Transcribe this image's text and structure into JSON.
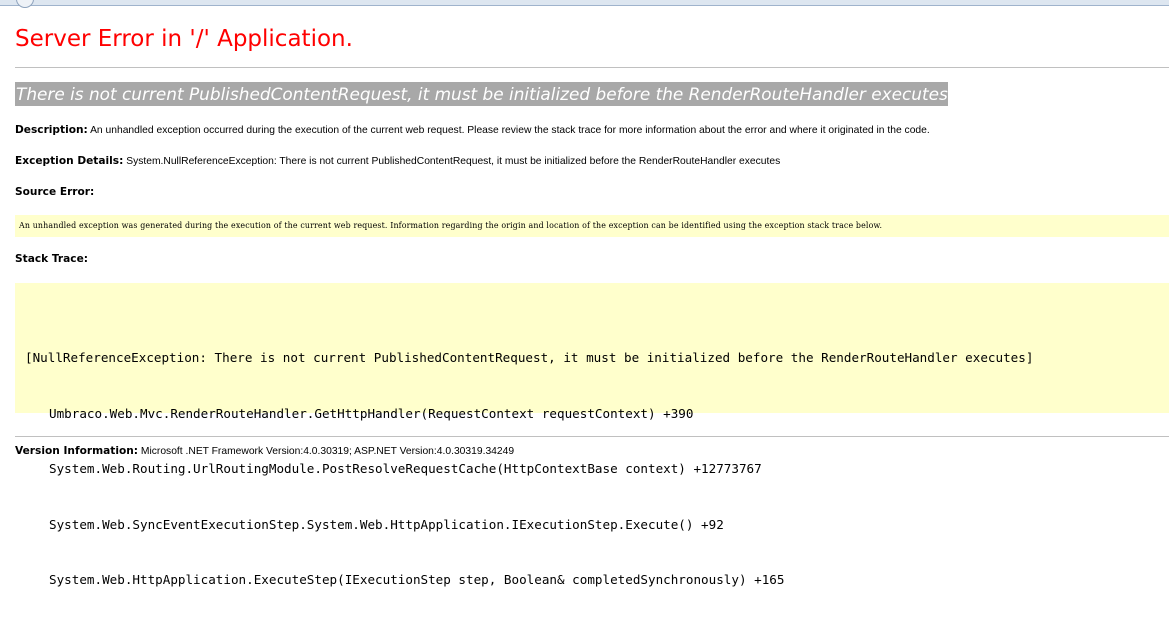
{
  "page": {
    "title": "Server Error in '/' Application.",
    "error_heading": "There is not current PublishedContentRequest, it must be initialized before the RenderRouteHandler executes"
  },
  "description": {
    "label": "Description:",
    "text": "An unhandled exception occurred during the execution of the current web request. Please review the stack trace for more information about the error and where it originated in the code."
  },
  "exception_details": {
    "label": "Exception Details:",
    "text": "System.NullReferenceException: There is not current PublishedContentRequest, it must be initialized before the RenderRouteHandler executes"
  },
  "source_error": {
    "label": "Source Error:",
    "text": "An unhandled exception was generated during the execution of the current web request. Information regarding the origin and location of the exception can be identified using the exception stack trace below."
  },
  "stack_trace": {
    "label": "Stack Trace:",
    "header": "[NullReferenceException: There is not current PublishedContentRequest, it must be initialized before the RenderRouteHandler executes]",
    "frames": [
      "Umbraco.Web.Mvc.RenderRouteHandler.GetHttpHandler(RequestContext requestContext) +390",
      "System.Web.Routing.UrlRoutingModule.PostResolveRequestCache(HttpContextBase context) +12773767",
      "System.Web.SyncEventExecutionStep.System.Web.HttpApplication.IExecutionStep.Execute() +92",
      "System.Web.HttpApplication.ExecuteStep(IExecutionStep step, Boolean& completedSynchronously) +165"
    ]
  },
  "version_info": {
    "label": "Version Information:",
    "text": "Microsoft .NET Framework Version:4.0.30319; ASP.NET Version:4.0.30319.34249"
  },
  "colors": {
    "title": "#ff0000",
    "heading_background": "#a8a8a8",
    "code_background": "#ffffcc"
  }
}
